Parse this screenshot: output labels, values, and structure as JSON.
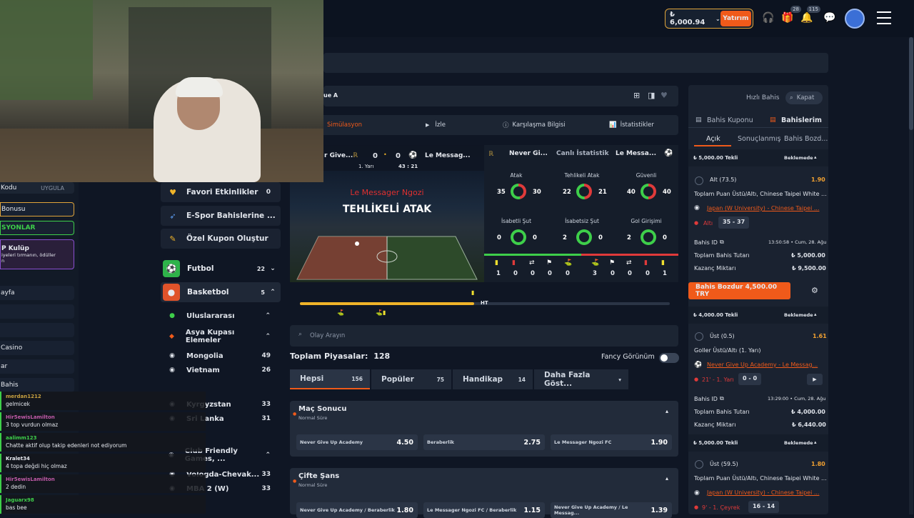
{
  "header": {
    "balance": "₺ 6,000.94",
    "deposit_label": "Yatırım",
    "gift_badge": "28",
    "bell_badge": "115"
  },
  "breadcrumb": {
    "league_fragment": "ue A"
  },
  "left_sidebar": {
    "rows": [
      "Kodu",
      "UYGULA",
      "Bonusu",
      "SYONLAR",
      "P Kulüp",
      "iyeleri tırmanın, ödüller",
      "n",
      "ayfa",
      "Casino",
      "ar",
      "Bahis"
    ]
  },
  "chat": [
    {
      "user": "merdan1212",
      "text": "gelmicek",
      "color": "#c7a040"
    },
    {
      "user": "Hir5ewisLamilton",
      "text": "3 top vurdun olmaz",
      "color": "#c05aa8"
    },
    {
      "user": "aalimm123",
      "text": "Chatte aktif olup takip edenleri not ediyorum",
      "color": "#3ecf4a"
    },
    {
      "user": "Kralet34",
      "text": "4 topa değdi hiç olmaz",
      "color": "#e6e9ef"
    },
    {
      "user": "Hir5ewisLamilton",
      "text": "2 dedin",
      "color": "#c05aa8"
    },
    {
      "user": "Jaguarx98",
      "text": "bas bee",
      "color": "#3ecf4a"
    }
  ],
  "nav": {
    "favorites": {
      "label": "Favori Etkinlikler",
      "count": "0"
    },
    "esports": {
      "label": "E-Spor Bahislerine ..."
    },
    "coupon": {
      "label": "Özel Kupon Oluştur"
    },
    "football": {
      "label": "Futbol",
      "count": "22"
    },
    "basketball": {
      "label": "Basketbol",
      "count": "5"
    },
    "intl": {
      "label": "Uluslararası"
    },
    "asia": {
      "label": "Asya Kupası Elemeler"
    },
    "mongolia": {
      "label": "Mongolia",
      "count": "49"
    },
    "vietnam": {
      "label": "Vietnam",
      "count": "26"
    },
    "kyrgyzstan": {
      "label": "Kyrgyzstan",
      "count": "33"
    },
    "srilanka": {
      "label": "Sri Lanka",
      "count": "31"
    },
    "club": {
      "label": "Club Friendly Games, ..."
    },
    "vologda": {
      "label": "Vologda-Chevak...",
      "count": "33"
    },
    "mba": {
      "label": "MBA 2 (W)",
      "count": "33"
    }
  },
  "match_tabs": {
    "sim": "Simülasyon",
    "watch": "İzle",
    "info": "Karşılaşma Bilgisi",
    "stats": "İstatistikler"
  },
  "scoreboard": {
    "home": "r Give...",
    "away": "Le Messag...",
    "home_score": "0",
    "away_score": "0",
    "period": "1. Yarı",
    "clock": "43 : 21",
    "alert_team": "Le Messager Ngozi",
    "alert_text": "TEHLİKELİ ATAK"
  },
  "live_stats": {
    "home": "Never Gi...",
    "title": "Canlı İstatistik",
    "away": "Le Messa...",
    "items": [
      {
        "label": "Atak",
        "home": "35",
        "away": "30"
      },
      {
        "label": "Tehlikeli Atak",
        "home": "22",
        "away": "21"
      },
      {
        "label": "Güvenli",
        "home": "40",
        "away": "40"
      },
      {
        "label": "İsabetli Şut",
        "home": "0",
        "away": "0"
      },
      {
        "label": "İsabetsiz Şut",
        "home": "2",
        "away": "0"
      },
      {
        "label": "Gol Girişimi",
        "home": "2",
        "away": "0"
      }
    ],
    "cards_home": [
      "1",
      "0",
      "0",
      "0",
      "0"
    ],
    "cards_away": [
      "3",
      "0",
      "0",
      "0",
      "1"
    ]
  },
  "timeline": {
    "ht": "HT"
  },
  "search": {
    "placeholder": "Olay Arayın"
  },
  "markets": {
    "total_label": "Toplam Piyasalar:",
    "total": "128",
    "fancy": "Fancy Görünüm"
  },
  "market_tabs": [
    {
      "label": "Hepsi",
      "count": "156"
    },
    {
      "label": "Popüler",
      "count": "75"
    },
    {
      "label": "Handikap",
      "count": "14"
    },
    {
      "label": "Daha Fazla Göst...",
      "count": ""
    }
  ],
  "market1": {
    "title": "Maç Sonucu",
    "sub": "Normal Süre",
    "odds": [
      {
        "label": "Never Give Up Academy",
        "value": "4.50"
      },
      {
        "label": "Beraberlik",
        "value": "2.75"
      },
      {
        "label": "Le Messager Ngozi FC",
        "value": "1.90"
      }
    ]
  },
  "market2": {
    "title": "Çifte Şans",
    "sub": "Normal Süre",
    "odds": [
      {
        "label": "Never Give Up Academy / Beraberlik",
        "value": "1.80"
      },
      {
        "label": "Le Messager Ngozi FC / Beraberlik",
        "value": "1.15"
      },
      {
        "label": "Never Give Up Academy / Le Messag...",
        "value": "1.39"
      }
    ]
  },
  "betslip": {
    "quick": "Hızlı Bahis",
    "close": "Kapat",
    "coupon_tab": "Bahis Kuponu",
    "mybets_tab": "Bahislerim",
    "sub_open": "Açık",
    "sub_settled": "Sonuçlanmış",
    "sub_cashout": "Bahis Bozd...",
    "bet1": {
      "head": "₺ 5,000.00 Tekli",
      "status": "Beklemede",
      "sel": "Alt (73.5)",
      "odd": "1.90",
      "market": "Toplam Puan Üstü/Altı, Chinese Taipei White ...",
      "event": "Japan (W University) - Chinese Taipei ...",
      "score_label": "Altı",
      "score": "35 - 37",
      "id_label": "Bahis ID",
      "time": "13:50:58 • Cum, 28. Ağu",
      "stake_label": "Toplam Bahis Tutarı",
      "stake": "₺ 5,000.00",
      "win_label": "Kazanç Miktarı",
      "win": "₺ 9,500.00",
      "cashout": "Bahis Bozdur 4,500.00 TRY"
    },
    "bet2": {
      "head": "₺ 4,000.00 Tekli",
      "status": "Beklemede",
      "sel": "Üst (0.5)",
      "odd": "1.61",
      "market": "Goller Üstü/Altı (1. Yarı)",
      "event": "Never Give Up Academy - Le Messag...",
      "score_label": "21' - 1. Yarı",
      "score": "0 - 0",
      "id_label": "Bahis ID",
      "time": "13:29:00 • Cum, 28. Ağu",
      "stake_label": "Toplam Bahis Tutarı",
      "stake": "₺ 4,000.00",
      "win_label": "Kazanç Miktarı",
      "win": "₺ 6,440.00"
    },
    "bet3": {
      "head": "₺ 5,000.00 Tekli",
      "status": "Beklemede",
      "sel": "Üst (59.5)",
      "odd": "1.80",
      "market": "Toplam Puan Üstü/Altı, Chinese Taipei White ...",
      "event": "Japan (W University) - Chinese Taipei ...",
      "score_label": "9' - 1. Çeyrek",
      "score": "16 - 14"
    }
  }
}
